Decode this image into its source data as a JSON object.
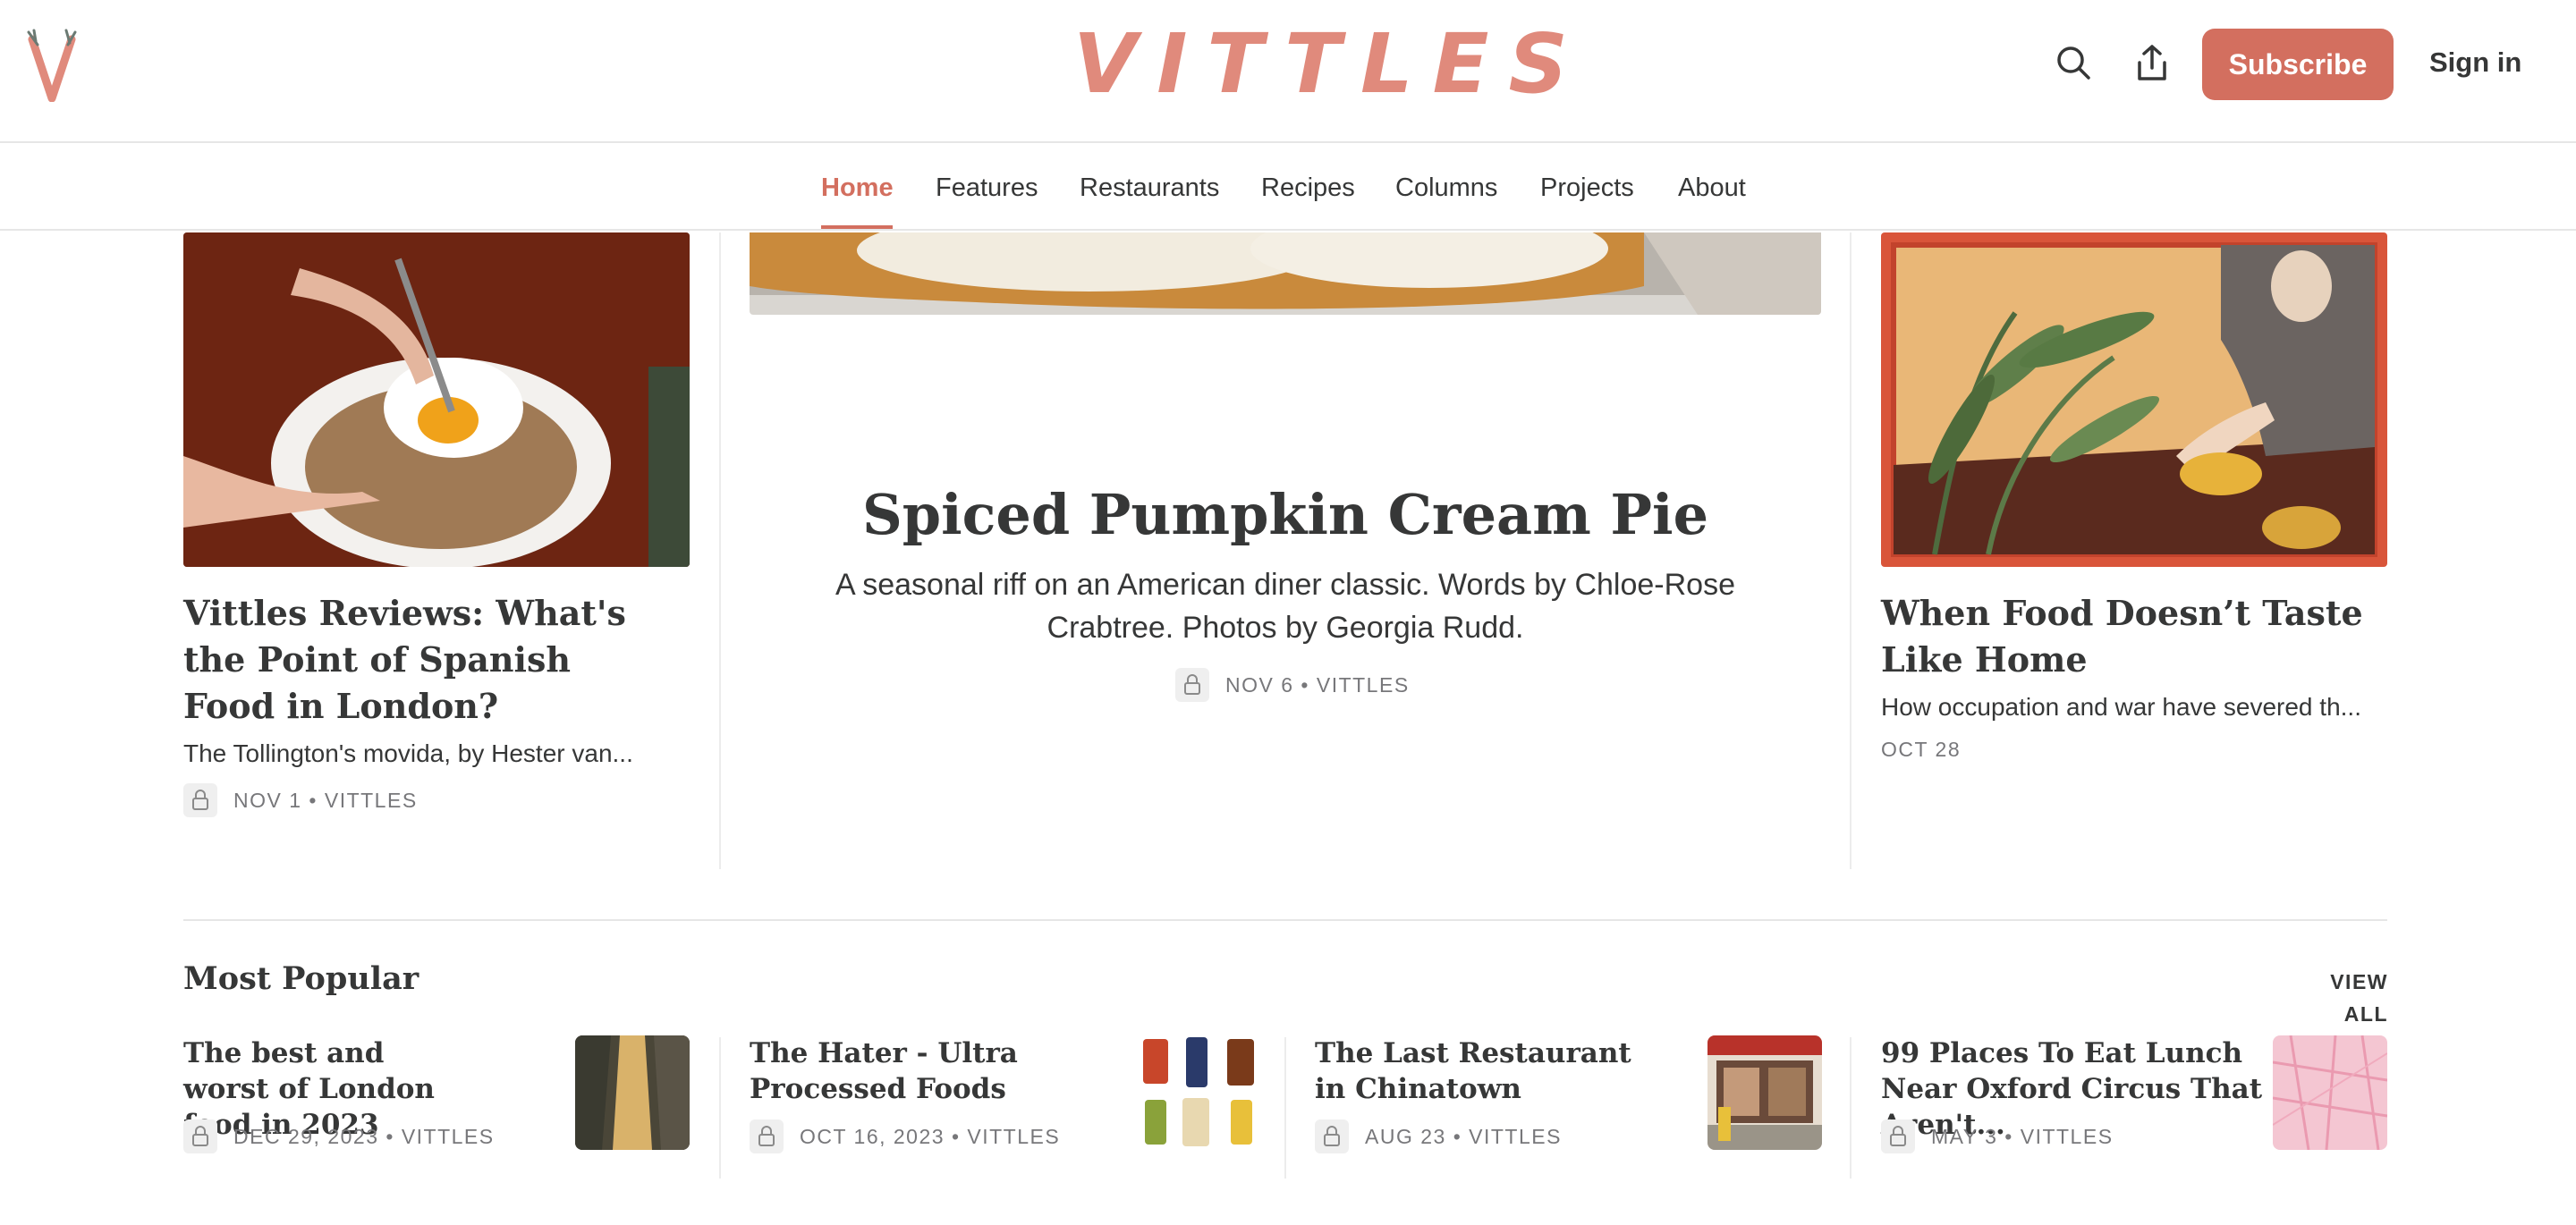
{
  "header": {
    "brand": "VITTLES",
    "subscribe_label": "Subscribe",
    "signin_label": "Sign in"
  },
  "nav": {
    "items": [
      {
        "label": "Home",
        "active": true
      },
      {
        "label": "Features"
      },
      {
        "label": "Restaurants"
      },
      {
        "label": "Recipes"
      },
      {
        "label": "Columns"
      },
      {
        "label": "Projects"
      },
      {
        "label": "About"
      }
    ]
  },
  "top_posts": {
    "left": {
      "title": "Vittles Reviews: What's the Point of Spanish Food in London?",
      "subtitle": "The Tollington's movida, by Hester van...",
      "meta": "NOV 1 • VITTLES",
      "locked": true
    },
    "feature": {
      "title": "Spiced Pumpkin Cream Pie",
      "subtitle": "A seasonal riff on an American diner classic. Words by Chloe-Rose Crabtree. Photos by Georgia Rudd.",
      "meta": "NOV 6 • VITTLES",
      "locked": true
    },
    "right": {
      "title": "When Food Doesn’t Taste Like Home",
      "subtitle": "How occupation and war have severed th...",
      "meta": "OCT 28"
    }
  },
  "most_popular": {
    "title": "Most Popular",
    "view_all": "VIEW ALL",
    "items": [
      {
        "title": "The best and worst of London food in 2023",
        "meta": "DEC 29, 2023 • VITTLES"
      },
      {
        "title": "The Hater - Ultra Processed Foods",
        "meta": "OCT 16, 2023 • VITTLES"
      },
      {
        "title": "The Last Restaurant in Chinatown",
        "meta": "AUG 23 • VITTLES"
      },
      {
        "title": "99 Places To Eat Lunch Near Oxford Circus That Aren't...",
        "meta": "MAY 3 • VITTLES"
      }
    ]
  },
  "colors": {
    "accent": "#d36f5f",
    "brand_pink": "#e08a7c",
    "text": "#363737",
    "meta": "#77777a"
  }
}
